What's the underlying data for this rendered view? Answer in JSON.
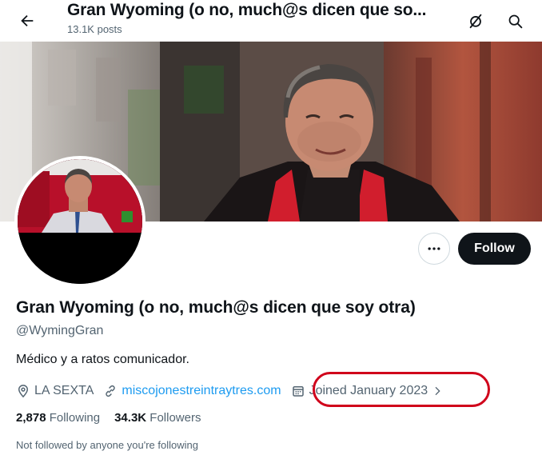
{
  "header": {
    "title": "Gran Wyoming (o no, much@s dicen que so...",
    "posts_count": "13.1K posts"
  },
  "actions": {
    "more_icon": "more-horizontal-icon",
    "follow_label": "Follow"
  },
  "profile": {
    "display_name": "Gran Wyoming (o no, much@s dicen que soy otra)",
    "handle": "@WymingGran",
    "bio": "Médico y a ratos comunicador.",
    "location": "LA SEXTA",
    "website": "miscojonestreintraytres.com",
    "joined": "Joined January 2023"
  },
  "stats": {
    "following_count": "2,878",
    "following_label": "Following",
    "followers_count": "34.3K",
    "followers_label": "Followers",
    "followed_by_note": "Not followed by anyone you're following"
  },
  "icons": {
    "back": "arrow-left-icon",
    "no_boost": "slashed-circle-icon",
    "search": "search-icon",
    "location": "location-pin-icon",
    "link": "link-icon",
    "calendar": "calendar-icon",
    "chevron": "chevron-right-icon"
  },
  "colors": {
    "text_primary": "#0f1419",
    "text_secondary": "#536471",
    "link": "#1d9bf0",
    "follow_bg": "#0f1419",
    "highlight_ring": "#d0021b"
  }
}
